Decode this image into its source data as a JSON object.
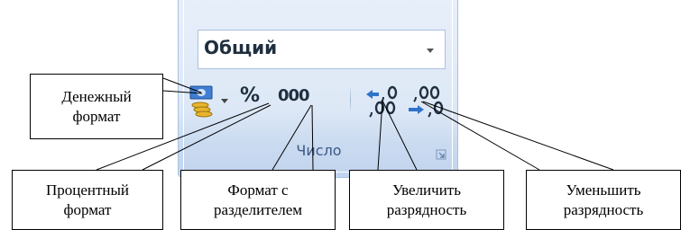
{
  "ribbon_group": {
    "title": "Число",
    "number_format": {
      "value": "Общий",
      "icon": "chevron-down-icon"
    },
    "tools": {
      "currency": {
        "icon": "accounting-currency-icon",
        "dropdown_icon": "chevron-down-icon"
      },
      "percent": {
        "label": "%"
      },
      "comma": {
        "label": "000"
      },
      "increase_decimal": {
        "icon": "increase-decimal-icon"
      },
      "decrease_decimal": {
        "icon": "decrease-decimal-icon"
      }
    },
    "dialog_launcher_icon": "dialog-launcher-icon"
  },
  "callouts": {
    "currency": "Денежный\nформат",
    "percent": "Процентный\nформат",
    "separator": "Формат с\nразделителем",
    "increase": "Увеличить\nразрядность",
    "decrease": "Уменьшить\nразрядность"
  },
  "colors": {
    "ribbon_border": "#a9c2df",
    "group_title": "#3c5a86",
    "icon_blue": "#2f73c9"
  }
}
